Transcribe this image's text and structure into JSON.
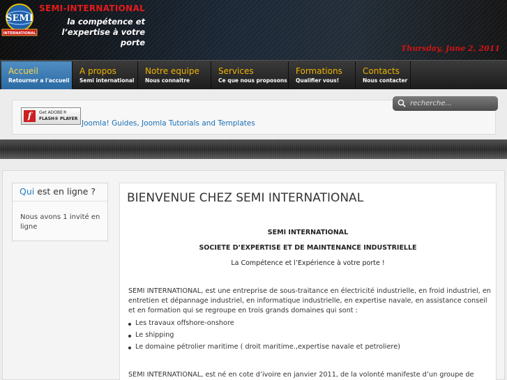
{
  "header": {
    "site_name": "SEMI-INTERNATIONAL",
    "slogan_line1": "la compétence et",
    "slogan_line2": "l’expertise à votre porte",
    "date": "Thursday, June 2, 2011",
    "logo": {
      "main_text": "SEMI",
      "banner_text": "INTERNATIONAL"
    }
  },
  "nav": {
    "items": [
      {
        "title": "Accueil",
        "subtitle": "Retourner a l'accueil",
        "active": true
      },
      {
        "title": "A propos",
        "subtitle": "Semi international",
        "active": false
      },
      {
        "title": "Notre equipe",
        "subtitle": "Nous connaitre",
        "active": false
      },
      {
        "title": "Services",
        "subtitle": "Ce que nous proposons",
        "active": false
      },
      {
        "title": "Formations",
        "subtitle": "Qualifier vous!",
        "active": false
      },
      {
        "title": "Contacts",
        "subtitle": "Nous contacter",
        "active": false
      }
    ]
  },
  "search": {
    "placeholder": "recherche..."
  },
  "flash_badge": {
    "line1": "Get ADOBE®",
    "line2": "FLASH® PLAYER",
    "logo_letter": "f"
  },
  "joomla_link": "Joomla! Guides, Joomla Tutorials and Templates",
  "sidebar": {
    "module_title_highlight": "Qui",
    "module_title_rest": " est en ligne ?",
    "module_body": "Nous avons 1 invité en ligne"
  },
  "main": {
    "title": "BIENVENUE CHEZ SEMI INTERNATIONAL",
    "heading1": "SEMI INTERNATIONAL",
    "heading2": "SOCIETE D’EXPERTISE ET DE MAINTENANCE INDUSTRIELLE",
    "tagline": "La Compétence et l’Expérience à votre porte !",
    "intro": "SEMI INTERNATIONAL, est une entreprise de sous-traitance en électricité industrielle, en froid industriel, en entretien et dépannage industriel, en informatique industrielle, en expertise navale, en assistance conseil et en formation qui se regroupe en trois grands domaines qui sont :",
    "domains": [
      "Les travaux offshore-onshore",
      "Le shipping",
      "Le domaine pétrolier maritime ( droit maritime.,expertise navale et petroliere)"
    ],
    "history": "SEMI INTERNATIONAL, est né en cote d’ivoire en janvier 2011, de la volonté manifeste d’un groupe de"
  },
  "colors": {
    "accent_blue": "#2c6aa3",
    "nav_gold": "#f0b400",
    "brand_red": "#e51b1b",
    "link_blue": "#1a6fb4"
  }
}
